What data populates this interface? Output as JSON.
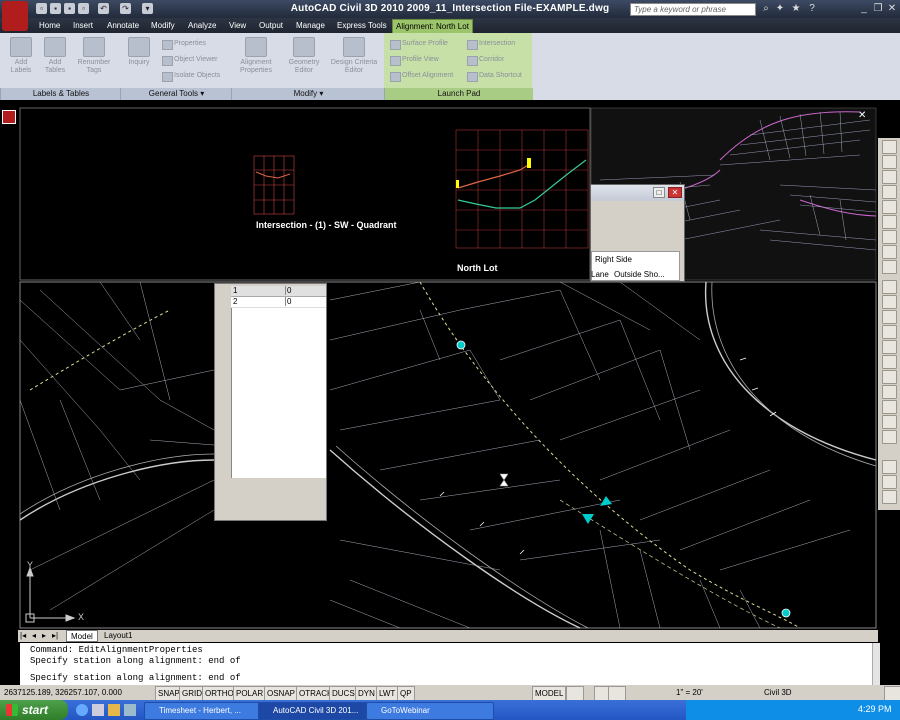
{
  "titlebar": {
    "title": "AutoCAD Civil 3D 2010     2009_11_Intersection File-EXAMPLE.dwg",
    "search_placeholder": "Type a keyword or phrase"
  },
  "tabs": [
    "Home",
    "Insert",
    "Annotate",
    "Modify",
    "Analyze",
    "View",
    "Output",
    "Manage",
    "Express Tools",
    "Alignment: North Lot"
  ],
  "ribbon": {
    "panels": [
      {
        "label": "Labels & Tables",
        "buttons": [
          "Add Labels",
          "Add Tables",
          "Renumber Tags"
        ]
      },
      {
        "label": "General Tools",
        "buttons": [
          "Inquiry"
        ],
        "small": [
          "Properties",
          "Object Viewer",
          "Isolate Objects"
        ]
      },
      {
        "label": "Modify",
        "buttons": [
          "Alignment Properties",
          "Geometry Editor",
          "Design Criteria Editor"
        ]
      },
      {
        "label": "Launch Pad",
        "small": [
          "Surface Profile",
          "Profile View",
          "Offset Alignment",
          "Intersection",
          "Corridor",
          "Data Shortcut"
        ]
      }
    ]
  },
  "drawing": {
    "profile_label_1": "Intersection - (1) - SW - Quadrant",
    "profile_label_2": "North Lot",
    "ucs_x": "X",
    "ucs_y": "Y"
  },
  "prop_window": {
    "row1": "Right Side",
    "row2a": "Lane",
    "row2b": "Outside Sho..."
  },
  "table_window": {
    "rows": [
      {
        "num": "1",
        "val": "0"
      },
      {
        "num": "2",
        "val": "0"
      }
    ]
  },
  "layout_tabs": [
    "Model",
    "Layout1"
  ],
  "command_line": [
    "Command: EditAlignmentProperties",
    "Specify station along alignment: end of",
    "Specify station along alignment: end of"
  ],
  "status": {
    "coords": "2637125.189, 326257.107, 0.000",
    "toggles": [
      "SNAP",
      "GRID",
      "ORTHO",
      "POLAR",
      "OSNAP",
      "OTRACK",
      "DUCS",
      "DYN",
      "LWT",
      "QP"
    ],
    "model": "MODEL",
    "scale": "1\" = 20'",
    "workspace": "Civil 3D"
  },
  "taskbar": {
    "start": "start",
    "tasks": [
      "Timesheet - Herbert, ...",
      "AutoCAD Civil 3D 201...",
      "GoToWebinar"
    ],
    "clock": "4:29 PM"
  }
}
